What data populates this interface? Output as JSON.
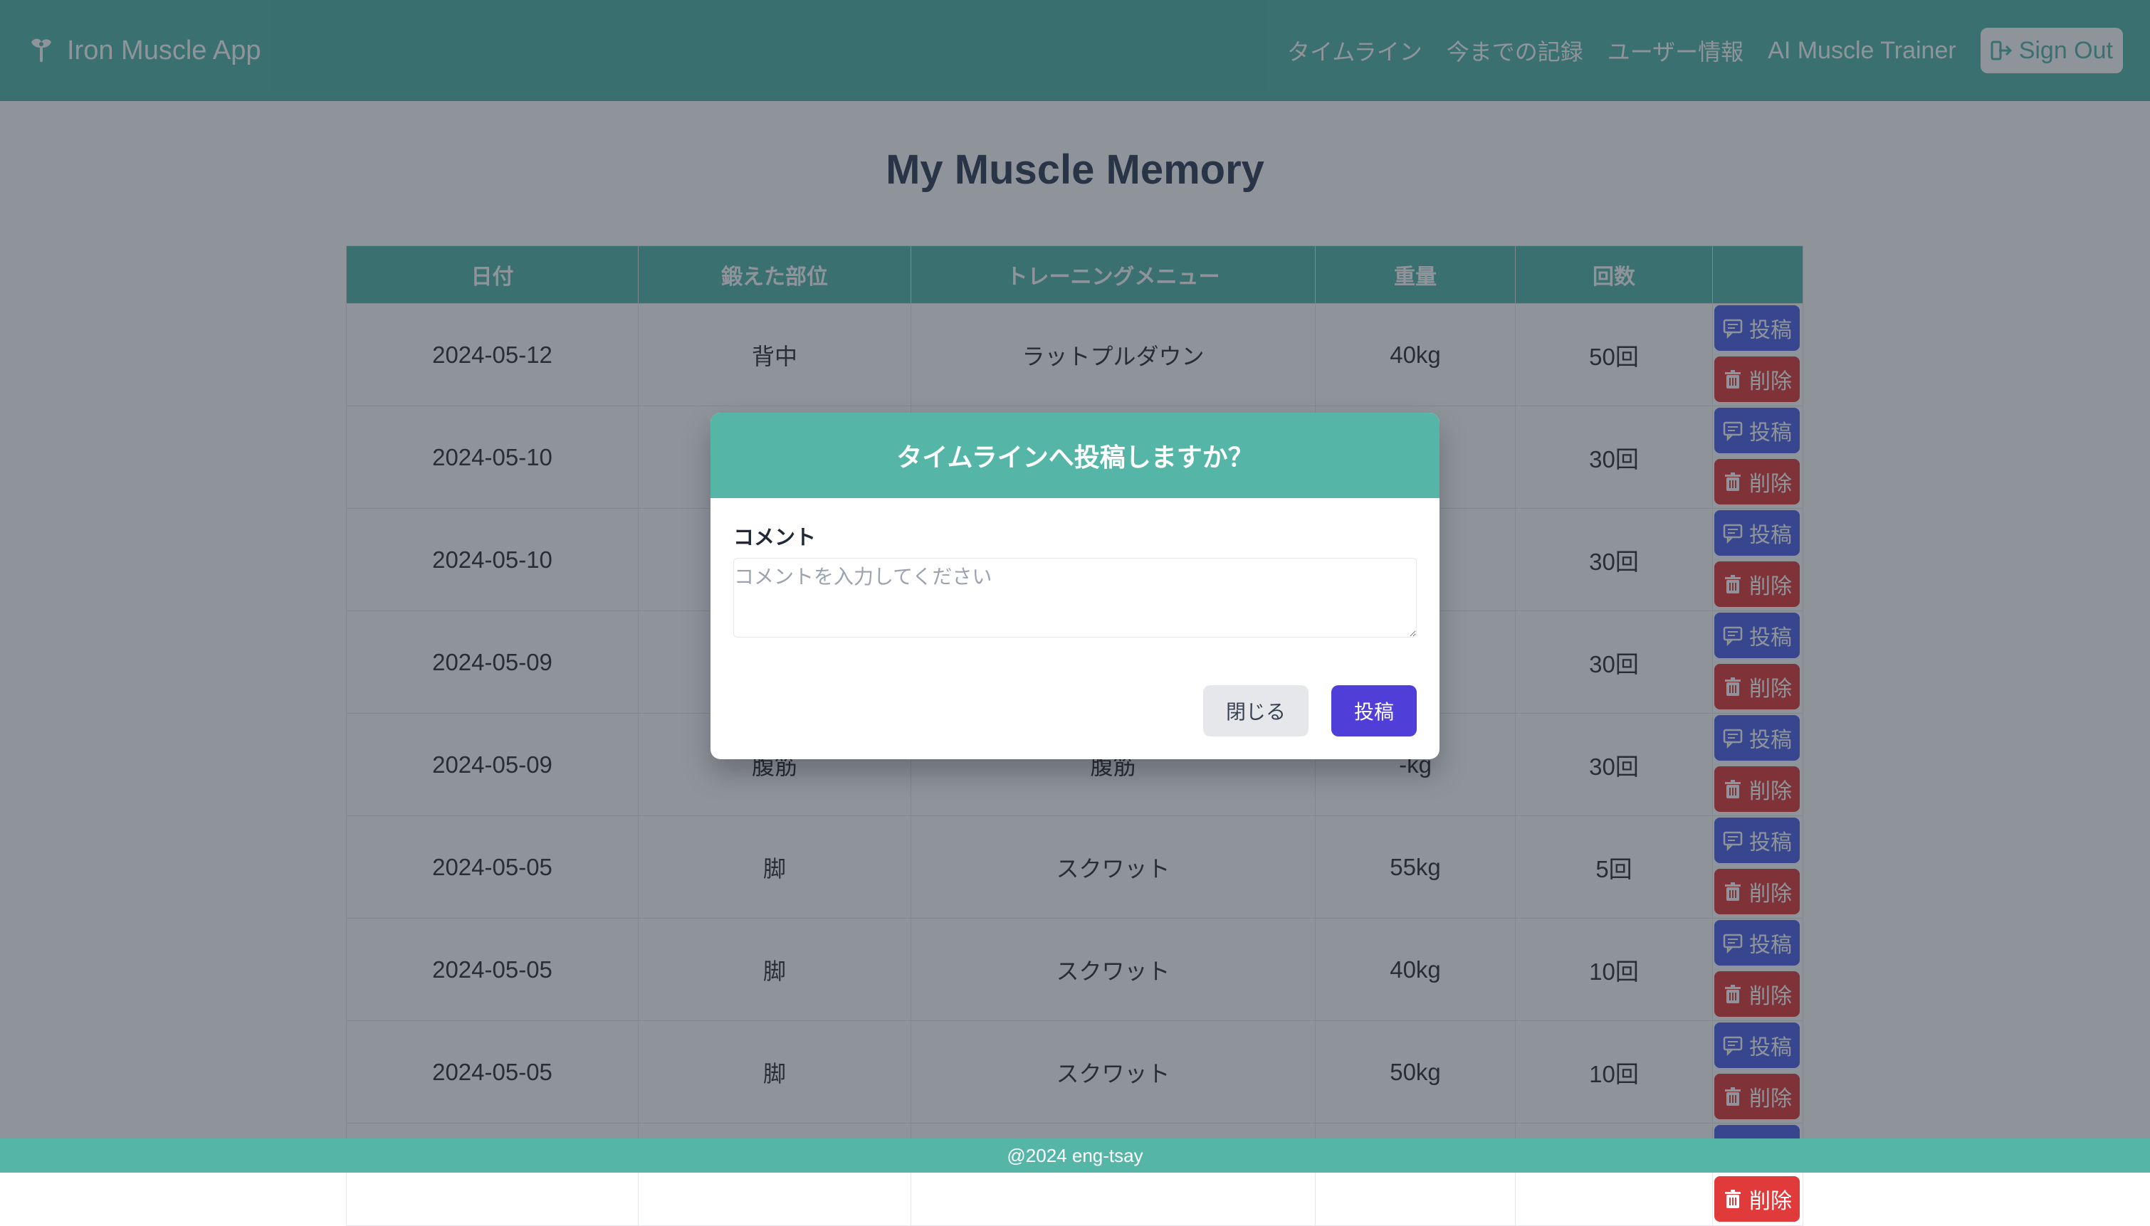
{
  "navbar": {
    "brand": "Iron Muscle App",
    "brand_icon": "flexed-arm-icon",
    "links": [
      "タイムライン",
      "今までの記録",
      "ユーザー情報",
      "AI Muscle Trainer"
    ],
    "sign_out": "Sign Out",
    "sign_out_icon": "sign-out-icon"
  },
  "page": {
    "title": "My Muscle Memory"
  },
  "table": {
    "headers": [
      "日付",
      "鍛えた部位",
      "トレーニングメニュー",
      "重量",
      "回数",
      ""
    ],
    "rows": [
      {
        "date": "2024-05-12",
        "part": "背中",
        "menu": "ラットプルダウン",
        "weight": "40kg",
        "reps": "50回"
      },
      {
        "date": "2024-05-10",
        "part": "",
        "menu": "",
        "weight": "",
        "reps": "30回"
      },
      {
        "date": "2024-05-10",
        "part": "",
        "menu": "",
        "weight": "",
        "reps": "30回"
      },
      {
        "date": "2024-05-09",
        "part": "",
        "menu": "",
        "weight": "",
        "reps": "30回"
      },
      {
        "date": "2024-05-09",
        "part": "腹筋",
        "menu": "腹筋",
        "weight": "-kg",
        "reps": "30回"
      },
      {
        "date": "2024-05-05",
        "part": "脚",
        "menu": "スクワット",
        "weight": "55kg",
        "reps": "5回"
      },
      {
        "date": "2024-05-05",
        "part": "脚",
        "menu": "スクワット",
        "weight": "40kg",
        "reps": "10回"
      },
      {
        "date": "2024-05-05",
        "part": "脚",
        "menu": "スクワット",
        "weight": "50kg",
        "reps": "10回"
      },
      {
        "date": "",
        "part": "",
        "menu": "",
        "weight": "",
        "reps": ""
      }
    ],
    "post_label": "投稿",
    "delete_label": "削除"
  },
  "modal": {
    "title": "タイムラインへ投稿しますか？",
    "comment_label": "コメント",
    "comment_placeholder": "コメントを入力してください",
    "comment_value": "",
    "close_label": "閉じる",
    "submit_label": "投稿"
  },
  "footer": {
    "text": "@2024 eng-tsay"
  },
  "colors": {
    "accent": "#55b6a8",
    "post_button": "#4f62e6",
    "delete_button": "#e03a3a",
    "submit_button": "#4f3fd8",
    "overlay": "rgba(31,41,55,0.5)"
  }
}
